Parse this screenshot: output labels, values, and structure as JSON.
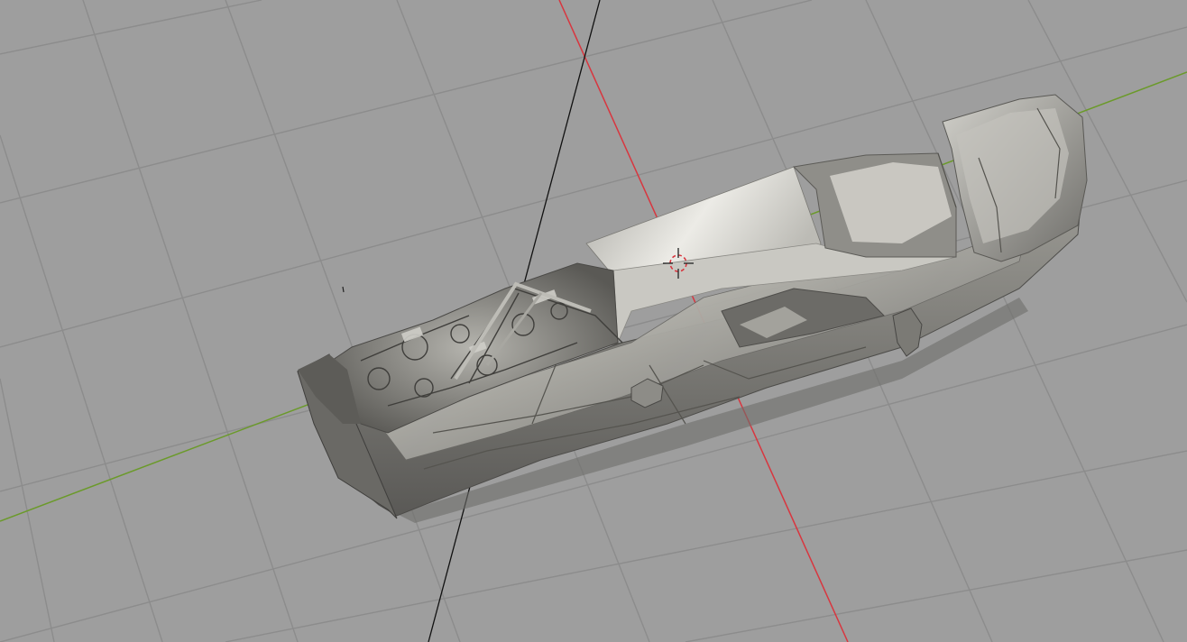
{
  "viewport": {
    "kind": "3d-viewport",
    "mode": "solid-shading",
    "background_color": "#9e9e9e",
    "grid_color": "#8a8a8a",
    "x_axis_color": "#d8363f",
    "y_axis_color": "#6b9a2a",
    "z_axis_color": "#111111",
    "model": "car-chassis-model"
  }
}
